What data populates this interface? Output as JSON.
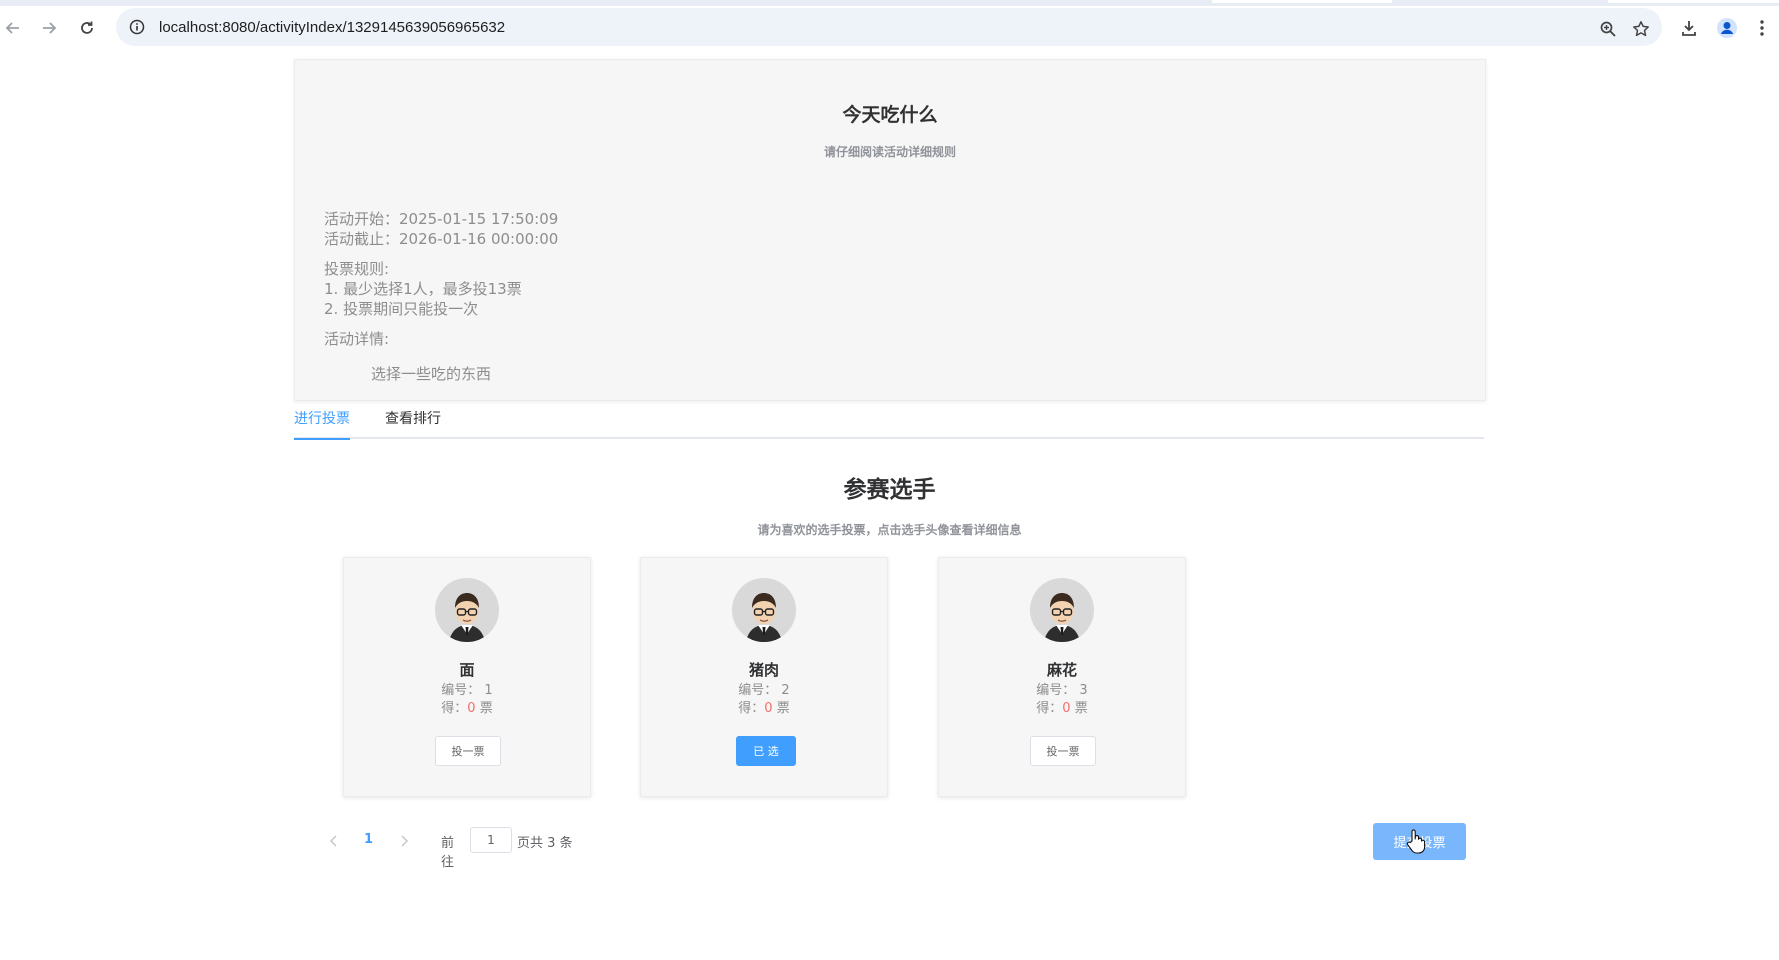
{
  "browser": {
    "url": "localhost:8080/activityIndex/1329145639056965632"
  },
  "activity": {
    "title": "今天吃什么",
    "subtitle": "请仔细阅读活动详细规则",
    "start_line": "活动开始：2025-01-15 17:50:09",
    "end_line": "活动截止：2026-01-16 00:00:00",
    "rules_label": "投票规则:",
    "rule_1": "1. 最少选择1人，最多投13票",
    "rule_2": "2. 投票期间只能投一次",
    "details_label": "活动详情:",
    "details_text": "选择一些吃的东西"
  },
  "tabs": [
    {
      "label": "进行投票",
      "active": true
    },
    {
      "label": "查看排行",
      "active": false
    }
  ],
  "contestants_section": {
    "title": "参赛选手",
    "subtitle": "请为喜欢的选手投票，点击选手头像查看详细信息"
  },
  "contestants": [
    {
      "name": "面",
      "number_line": "编号： 1",
      "votes_prefix": "得：",
      "votes": "0",
      "votes_suffix": " 票",
      "button": "投一票",
      "selected": false
    },
    {
      "name": "猪肉",
      "number_line": "编号： 2",
      "votes_prefix": "得：",
      "votes": "0",
      "votes_suffix": " 票",
      "button": "已 选",
      "selected": true
    },
    {
      "name": "麻花",
      "number_line": "编号： 3",
      "votes_prefix": "得：",
      "votes": "0",
      "votes_suffix": " 票",
      "button": "投一票",
      "selected": false
    }
  ],
  "pagination": {
    "current_page": "1",
    "goto_label": "前往",
    "goto_value": "1",
    "total_text": "页共 3 条"
  },
  "submit": {
    "label": "提交投票"
  },
  "colors": {
    "primary": "#409eff",
    "vote_count": "#f56c6c",
    "submit_bg": "#7ab6fb"
  }
}
